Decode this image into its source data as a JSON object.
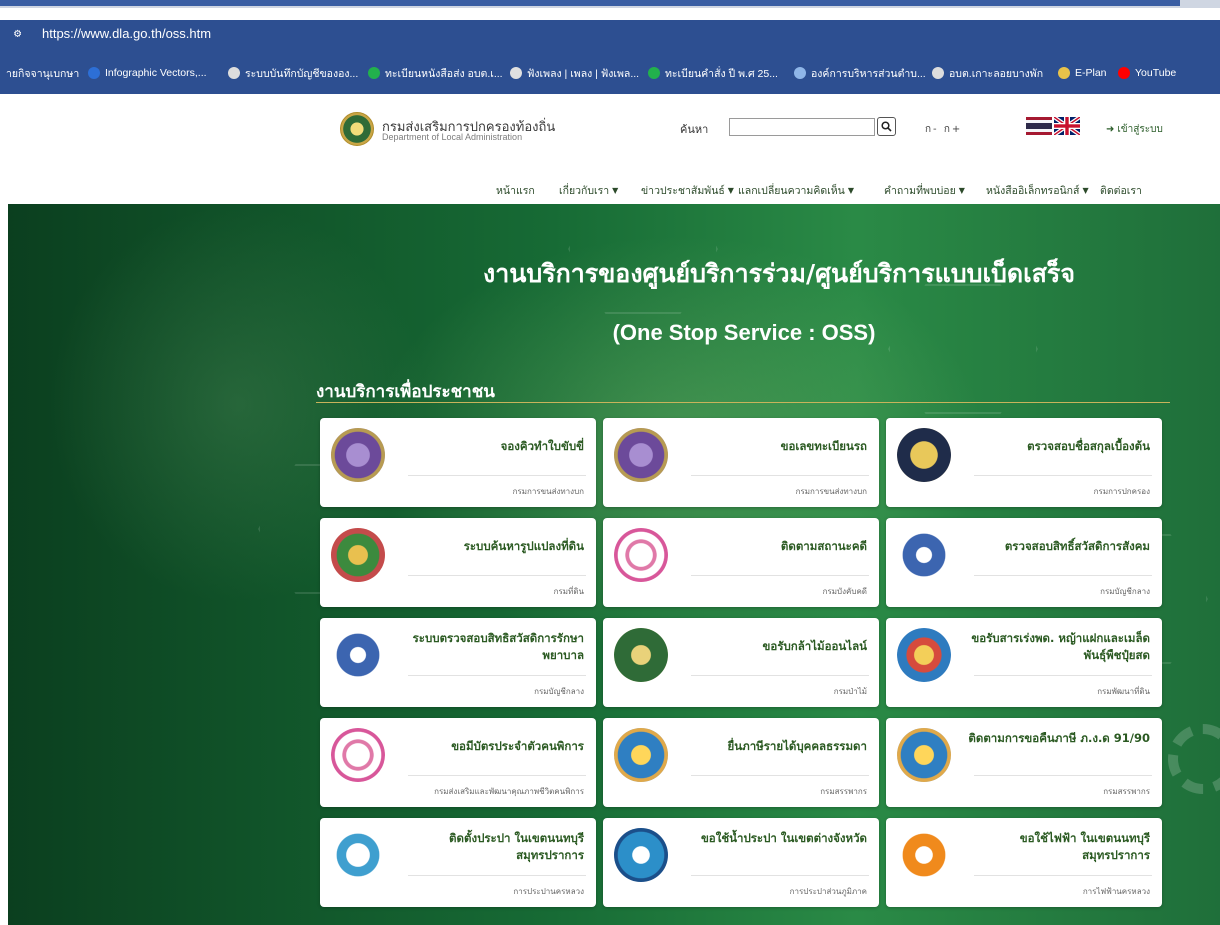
{
  "browser": {
    "url": "https://www.dla.go.th/oss.htm",
    "bookmarks": [
      {
        "label": "ายกิจจานุเบกษา",
        "icon": "bookmark-icon",
        "color": "#2d4f91"
      },
      {
        "label": "Infographic Vectors,...",
        "icon": "bookmark-icon",
        "color": "#2d6fd6"
      },
      {
        "label": "ระบบบันทึกบัญชีขององ...",
        "icon": "globe-icon",
        "color": "#dddddd"
      },
      {
        "label": "ทะเบียนหนังสือส่ง อบต.เ...",
        "icon": "cross-icon",
        "color": "#22b14c"
      },
      {
        "label": "ฟังเพลง | เพลง | ฟังเพล...",
        "icon": "music-icon",
        "color": "#e0e0e0"
      },
      {
        "label": "ทะเบียนคำสั่ง ปี พ.ศ 25...",
        "icon": "cross-icon",
        "color": "#22b14c"
      },
      {
        "label": "องค์การบริหารส่วนตำบ...",
        "icon": "site-icon",
        "color": "#8fb6e8"
      },
      {
        "label": "อบต.เกาะลอยบางพัก",
        "icon": "globe-icon",
        "color": "#dddddd"
      },
      {
        "label": "E-Plan",
        "icon": "eplan-icon",
        "color": "#e8c24a"
      },
      {
        "label": "YouTube",
        "icon": "youtube-icon",
        "color": "#ff0000"
      }
    ]
  },
  "header": {
    "logo_th": "กรมส่งเสริมการปกครองท้องถิ่น",
    "logo_en": "Department of Local Administration",
    "search_label": "ค้นหา",
    "search_value": "",
    "font_size": "ก- ก+",
    "login_label": "เข้าสู่ระบบ"
  },
  "nav": [
    {
      "label": "หน้าแรก",
      "caret": ""
    },
    {
      "label": "เกี่ยวกับเรา",
      "caret": "▼"
    },
    {
      "label": "ข่าวประชาสัมพันธ์",
      "caret": "▼"
    },
    {
      "label": "แลกเปลี่ยนความคิดเห็น",
      "caret": "▼"
    },
    {
      "label": "คำถามที่พบบ่อย",
      "caret": "▼"
    },
    {
      "label": "หนังสืออิเล็กทรอนิกส์",
      "caret": "▼"
    },
    {
      "label": "ติดต่อเรา",
      "caret": ""
    }
  ],
  "hero": {
    "title": "งานบริการของศูนย์บริการร่วม/ศูนย์บริการแบบเบ็ดเสร็จ",
    "subtitle": "(One Stop Service : OSS)",
    "section_title": "งานบริการเพื่อประชาชน"
  },
  "cards": [
    {
      "title": "จองคิวทำใบขับขี่",
      "agency": "กรมการขนส่งทางบก",
      "seal": "purple"
    },
    {
      "title": "ขอเลขทะเบียนรถ",
      "agency": "กรมการขนส่งทางบก",
      "seal": "purple"
    },
    {
      "title": "ตรวจสอบชื่อสกุลเบื้องต้น",
      "agency": "กรมการปกครอง",
      "seal": "dark"
    },
    {
      "title": "ระบบค้นหารูปแปลงที่ดิน",
      "agency": "กรมที่ดิน",
      "seal": "deity"
    },
    {
      "title": "ติดตามสถานะคดี",
      "agency": "กรมบังคับคดี",
      "seal": "pink"
    },
    {
      "title": "ตรวจสอบสิทธิ์สวัสดิการสังคม",
      "agency": "กรมบัญชีกลาง",
      "seal": "garuda"
    },
    {
      "title": "ระบบตรวจสอบสิทธิสวัสดิการรักษาพยาบาล",
      "agency": "กรมบัญชีกลาง",
      "seal": "garuda"
    },
    {
      "title": "ขอรับกล้าไม้ออนไลน์",
      "agency": "กรมป่าไม้",
      "seal": "forest"
    },
    {
      "title": "ขอรับสารเร่งพด. หญ้าแฝกและเมล็ดพันธุ์พืชปุ๋ยสด",
      "agency": "กรมพัฒนาที่ดิน",
      "seal": "land"
    },
    {
      "title": "ขอมีบัตรประจำตัวคนพิการ",
      "agency": "กรมส่งเสริมและพัฒนาคุณภาพชีวิตคนพิการ",
      "seal": "pink"
    },
    {
      "title": "ยื่นภาษีรายได้บุคคลธรรมดา",
      "agency": "กรมสรรพากร",
      "seal": "blue"
    },
    {
      "title": "ติดตามการขอคืนภาษี ภ.ง.ด 91/90",
      "agency": "กรมสรรพากร",
      "seal": "blue"
    },
    {
      "title": "ติดตั้งประปา ในเขตนนทบุรี สมุทรปราการ",
      "agency": "การประปานครหลวง",
      "seal": "pwa"
    },
    {
      "title": "ขอใช้น้ำประปา ในเขตต่างจังหวัด",
      "agency": "การประปาส่วนภูมิภาค",
      "seal": "water"
    },
    {
      "title": "ขอใช้ไฟฟ้า ในเขตนนทบุรี สมุทรปราการ",
      "agency": "การไฟฟ้านครหลวง",
      "seal": "elec"
    }
  ]
}
